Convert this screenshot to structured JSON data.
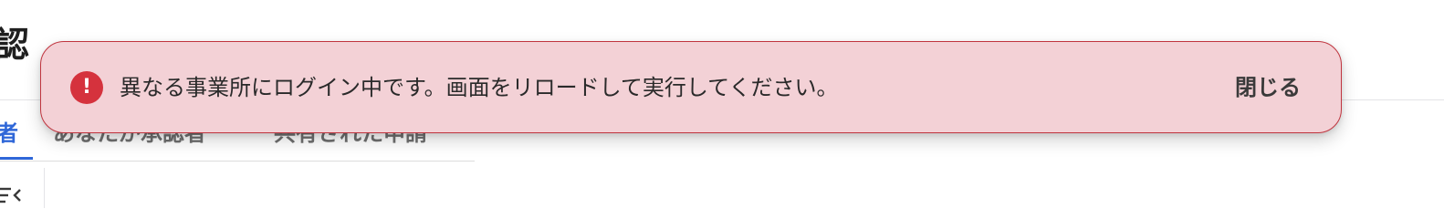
{
  "page": {
    "title": "認"
  },
  "tabs": [
    {
      "label": "者"
    },
    {
      "label": "あなたが承認者"
    },
    {
      "label": "共有された申請"
    }
  ],
  "toast": {
    "icon": "error-icon",
    "icon_glyph": "!",
    "message": "異なる事業所にログイン中です。画面をリロードして実行してください。",
    "close_label": "閉じる",
    "accent_color": "#d5323d",
    "background_color": "#f3d1d6"
  },
  "toolbar": {
    "sort_icon": "sort-icon"
  }
}
